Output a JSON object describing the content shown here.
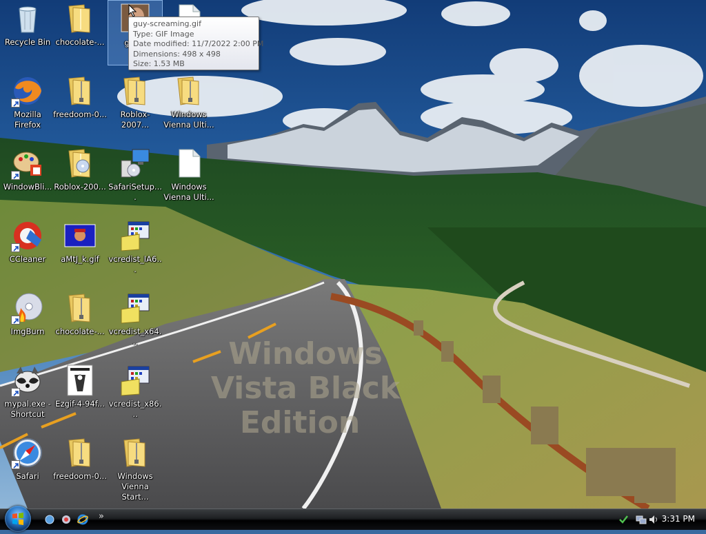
{
  "desktop": {
    "icons": [
      {
        "label": "Recycle Bin"
      },
      {
        "label": "chocolate-..."
      },
      {
        "label": "guy-s"
      },
      {
        "label": "Mozilla\nFirefox"
      },
      {
        "label": "freedoom-0..."
      },
      {
        "label": "Roblox-2007..."
      },
      {
        "label": "Windows\nVienna Ulti..."
      },
      {
        "label": "WindowBli..."
      },
      {
        "label": "Roblox-200..."
      },
      {
        "label": "SafariSetup...."
      },
      {
        "label": "Windows\nVienna Ulti..."
      },
      {
        "label": "CCleaner"
      },
      {
        "label": "aMtJ_k.gif"
      },
      {
        "label": "vcredist_IA6..."
      },
      {
        "label": "ImgBurn"
      },
      {
        "label": "chocolate-..."
      },
      {
        "label": "vcredist_x64..."
      },
      {
        "label": "mypal.exe -\nShortcut"
      },
      {
        "label": "Ezgif-4-94f..."
      },
      {
        "label": "vcredist_x86..."
      },
      {
        "label": "Safari"
      },
      {
        "label": "freedoom-0..."
      },
      {
        "label": "Windows\nVienna Start..."
      }
    ],
    "watermark": [
      "Windows",
      "Vista Black",
      "Edition"
    ]
  },
  "tooltip": {
    "name": "guy-screaming.gif",
    "type": "Type: GIF Image",
    "modified": "Date modified: 11/7/2022 2:00 PM",
    "dimensions": "Dimensions: 498 x 498",
    "size": "Size: 1.53 MB"
  },
  "taskbar": {
    "clock": "3:31 PM",
    "quicklaunch_more": "»"
  },
  "colors": {
    "taskbar": "#000000",
    "tooltip_bg": "#f2f2f6",
    "selection": "#78aae6"
  }
}
